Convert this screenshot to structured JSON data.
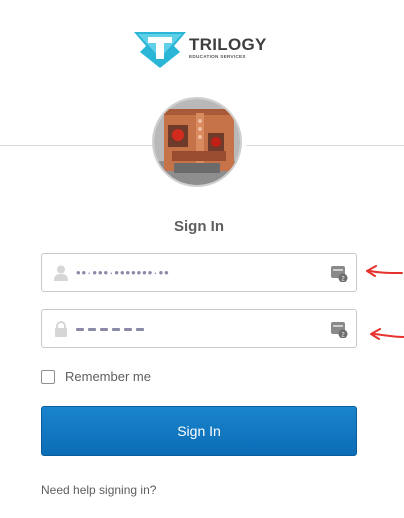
{
  "brand": {
    "name": "TRILOGY",
    "subtitle": "EDUCATION SERVICES",
    "accent_color": "#2bb5d6"
  },
  "title": "Sign In",
  "username_field": {
    "value": "••·•••·•••••••·••",
    "icon": "user-icon",
    "manager_icon": "password-manager-icon"
  },
  "password_field": {
    "dots": 6,
    "icon": "lock-icon",
    "manager_icon": "password-manager-icon"
  },
  "remember_me": {
    "label": "Remember me",
    "checked": false
  },
  "signin_button": {
    "label": "Sign In",
    "color": "#0f75bd"
  },
  "help_link": "Need help signing in?",
  "annotation_color": "#e5322d"
}
